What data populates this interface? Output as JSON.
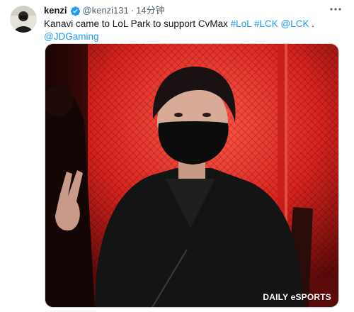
{
  "tweet": {
    "author_name": "kenzi",
    "handle": "@kenzi131",
    "separator": "·",
    "time": "14分钟",
    "text_main": "Kanavi came to LoL Park to support CvMax",
    "hashtags": [
      "#LoL",
      "#LCK"
    ],
    "mentions": [
      "@LCK",
      "@JDGaming"
    ],
    "text_period": "."
  },
  "media": {
    "watermark": "DAILY eSPORTS"
  },
  "icons": {
    "verified": "verified-badge-icon",
    "more": "more-options-icon"
  },
  "colors": {
    "link": "#1d9bf0",
    "verified": "#1d9bf0",
    "text": "#0f1419",
    "secondary": "#536471"
  }
}
